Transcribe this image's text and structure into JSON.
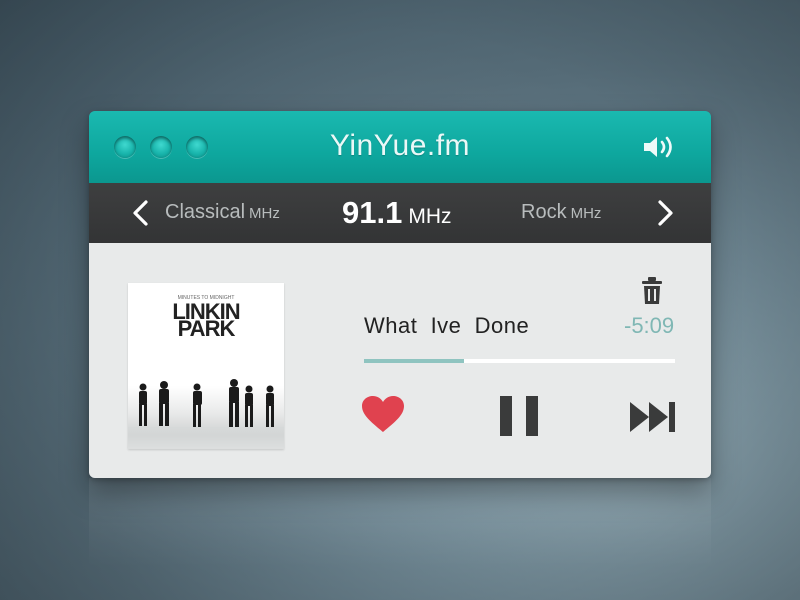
{
  "app": {
    "title": "YinYue.fm"
  },
  "stations": {
    "previous": {
      "name": "Classical",
      "unit": "MHz"
    },
    "current": {
      "frequency": "91.1",
      "unit": "MHz"
    },
    "next": {
      "name": "Rock",
      "unit": "MHz"
    }
  },
  "album": {
    "logo_line1": "LINKIN",
    "logo_line2": "PARK",
    "tiny_text": "MINUTES TO MIDNIGHT"
  },
  "track": {
    "title": "What  Ive  Done",
    "remaining": "-5:09",
    "progress_fraction": 0.32
  },
  "icons": {
    "window_dots": [
      "window-dot-icon",
      "window-dot-icon",
      "window-dot-icon"
    ],
    "volume": "volume-icon",
    "prev": "chevron-left-icon",
    "next": "chevron-right-icon",
    "delete": "trash-icon",
    "favorite": "heart-icon",
    "pause": "pause-icon",
    "skip": "skip-forward-icon"
  },
  "colors": {
    "accent": "#0ea79e",
    "station_bar": "#363738",
    "body_bg": "#e8eaea",
    "heart": "#e0424f",
    "progress": "#8fc4c0",
    "time": "#7fb7b4"
  }
}
